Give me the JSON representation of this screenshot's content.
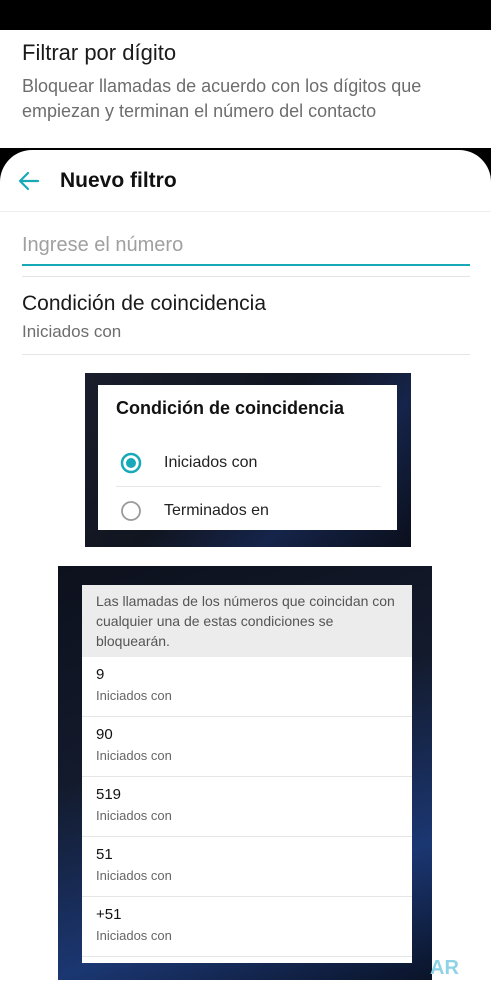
{
  "background_card": {
    "title": "Filtrar por dígito",
    "description": "Bloquear llamadas de acuerdo con los dígitos que empiezan y terminan el número del contacto"
  },
  "sheet": {
    "back_icon": "arrow-left-icon",
    "title": "Nuevo filtro",
    "number_input": {
      "placeholder": "Ingrese el número",
      "value": ""
    },
    "condition": {
      "label": "Condición de coincidencia",
      "value": "Iniciados con"
    }
  },
  "dialog": {
    "title": "Condición de coincidencia",
    "options": [
      {
        "label": "Iniciados con",
        "selected": true
      },
      {
        "label": "Terminados en",
        "selected": false
      }
    ]
  },
  "rules_list": {
    "note": "Las llamadas de los números que coincidan con cualquier una de estas condiciones se bloquearán.",
    "items": [
      {
        "number": "9",
        "condition": "Iniciados con"
      },
      {
        "number": "90",
        "condition": "Iniciados con"
      },
      {
        "number": "519",
        "condition": "Iniciados con"
      },
      {
        "number": "51",
        "condition": "Iniciados con"
      },
      {
        "number": "+51",
        "condition": "Iniciados con"
      }
    ]
  },
  "watermark": "AR",
  "colors": {
    "accent": "#17a9b8",
    "radio_selected": "#17a9b8"
  }
}
